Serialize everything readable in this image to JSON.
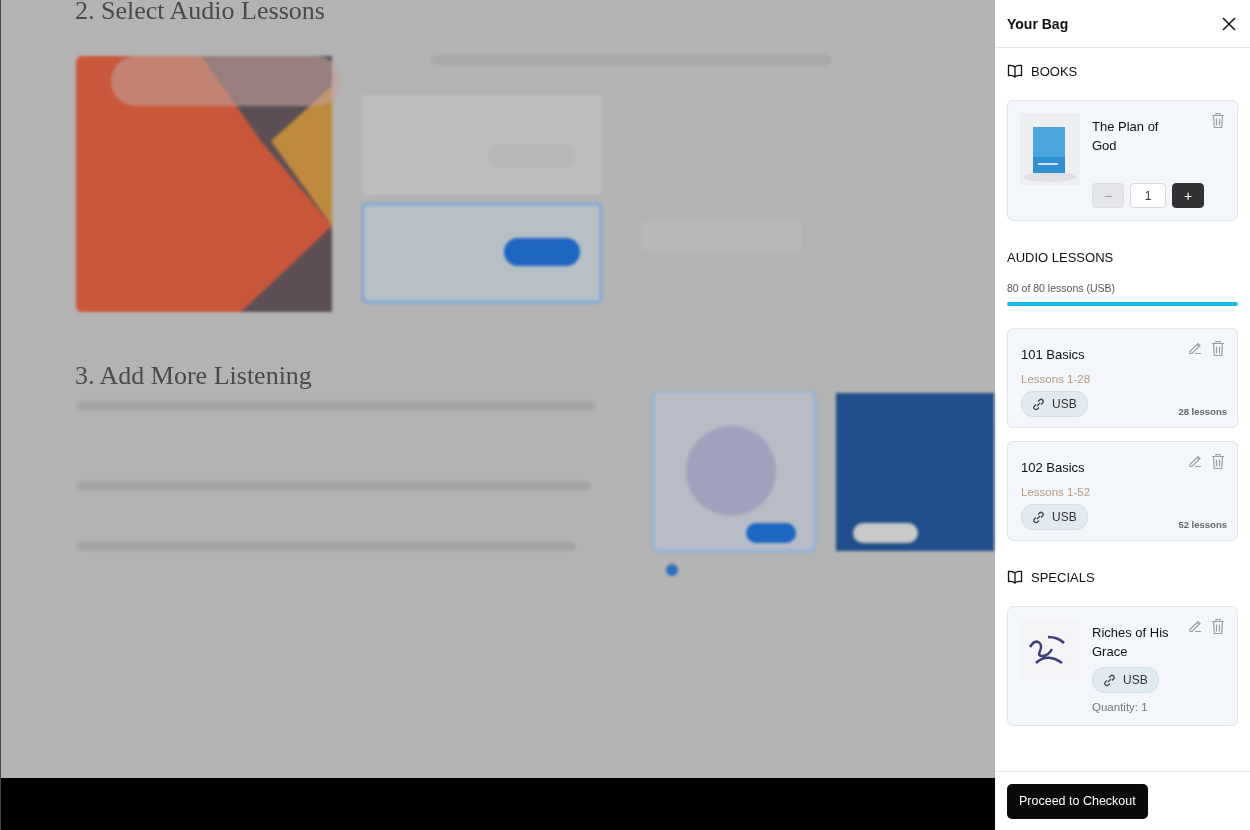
{
  "background": {
    "headings": [
      "2. Select Audio Lessons",
      "3. Add More Listening"
    ]
  },
  "bag": {
    "title": "Your Bag",
    "sections": [
      {
        "kind": "books",
        "title": "BOOKS",
        "items": [
          {
            "title": "The Plan of God",
            "decrement": "−",
            "quantity": "1",
            "increment": "+",
            "decrement_disabled": true
          }
        ]
      },
      {
        "kind": "audio",
        "title": "AUDIO LESSONS",
        "progress_label": "80 of 80 lessons (USB)",
        "level": 1,
        "items": [
          {
            "title": "101 Basics",
            "range": "Lessons 1-28",
            "format": "USB",
            "count": "28 lessons"
          },
          {
            "title": "102 Basics",
            "range": "Lessons 1-52",
            "format": "USB",
            "count": "52 lessons"
          }
        ]
      },
      {
        "kind": "specials",
        "title": "SPECIALS",
        "items": [
          {
            "title": "Riches of His Grace",
            "format": "USB",
            "quantity": "Quantity: 1"
          }
        ]
      }
    ],
    "checkout": "Proceed to Checkout"
  }
}
